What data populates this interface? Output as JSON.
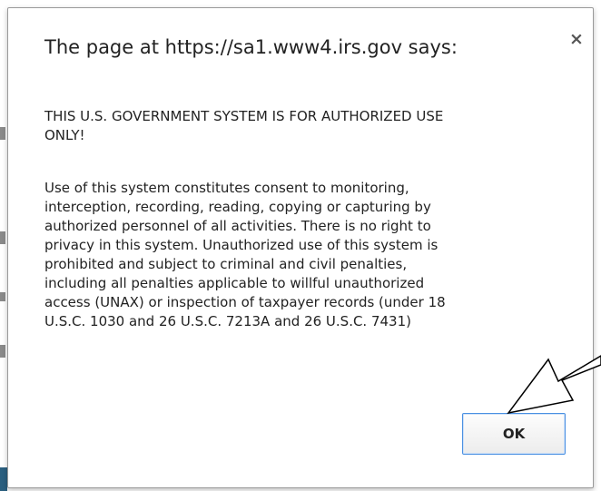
{
  "dialog": {
    "title": "The page at https://sa1.www4.irs.gov says:",
    "close_label": "×",
    "headline_lines": [
      "THIS U.S. GOVERNMENT SYSTEM IS FOR AUTHORIZED USE",
      "ONLY!"
    ],
    "body_lines": [
      "Use of this system constitutes consent to monitoring,",
      "interception, recording, reading, copying or capturing by",
      "authorized personnel of all activities. There is no right to",
      "privacy in this system. Unauthorized use of this system is",
      "prohibited and subject to criminal and civil penalties,",
      "including all penalties applicable to willful unauthorized",
      "access (UNAX) or inspection of taxpayer records (under 18",
      "U.S.C. 1030 and 26 U.S.C. 7213A and 26 U.S.C. 7431)"
    ],
    "ok_label": "OK"
  },
  "colors": {
    "focus_border": "#4a90e2",
    "text": "#222222"
  }
}
